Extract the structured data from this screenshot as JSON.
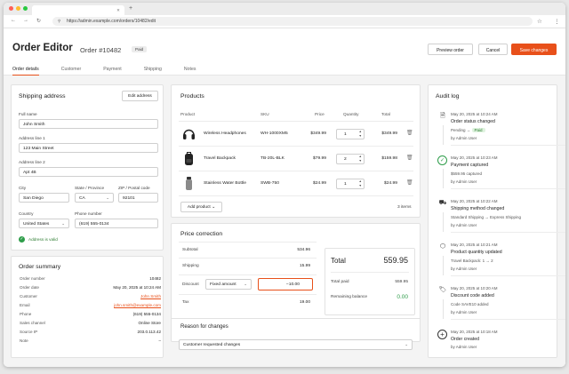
{
  "browser": {
    "tab_title": "",
    "new_tab": "+",
    "url": "https://admin.example.com/orders/10482/edit"
  },
  "header": {
    "title": "Order Editor",
    "order_number": "Order #10482",
    "status_badge": "Paid",
    "preview_label": "Preview order",
    "cancel_label": "Cancel",
    "save_label": "Save changes"
  },
  "tabs": [
    "Order details",
    "Customer",
    "Payment",
    "Shipping",
    "Notes"
  ],
  "shipping": {
    "title": "Shipping address",
    "edit_label": "Edit address",
    "full_name_label": "Full name",
    "full_name": "John Smith",
    "address1_label": "Address line 1",
    "address1": "123 Main Street",
    "address2_label": "Address line 2",
    "address2": "Apt 4B",
    "city_label": "City",
    "city": "San Diego",
    "state_label": "State / Province",
    "state": "CA",
    "zip_label": "ZIP / Postal code",
    "zip": "92101",
    "country_label": "Country",
    "country": "United States",
    "phone_label": "Phone number",
    "phone": "(619) 555-0134",
    "valid_msg": "Address is valid"
  },
  "summary": {
    "title": "Order summary",
    "rows": [
      {
        "k": "Order number",
        "v": "10482"
      },
      {
        "k": "Order date",
        "v": "May 20, 2025 at 10:24 AM"
      },
      {
        "k": "Customer",
        "v": "John Smith"
      },
      {
        "k": "Email",
        "v": "john.smith@example.com"
      },
      {
        "k": "Phone",
        "v": "(619) 555-0134"
      },
      {
        "k": "Sales channel",
        "v": "Online Store"
      },
      {
        "k": "Source IP",
        "v": "203.0.113.42"
      },
      {
        "k": "Note",
        "v": "–"
      }
    ]
  },
  "products": {
    "title": "Products",
    "headers": {
      "product": "Product",
      "sku": "SKU",
      "price": "Price",
      "quantity": "Quantity",
      "total": "Total"
    },
    "items": [
      {
        "name": "Wireless Headphones",
        "sku": "WH-1000XM5",
        "price": "$349.99",
        "qty": "1",
        "total": "$349.99"
      },
      {
        "name": "Travel Backpack",
        "sku": "TB-20L-BLK",
        "price": "$79.99",
        "qty": "2",
        "total": "$159.98"
      },
      {
        "name": "Stainless Water Bottle",
        "sku": "SWB-750",
        "price": "$24.99",
        "qty": "1",
        "total": "$24.99"
      }
    ],
    "add_label": "Add product",
    "count": "3 items"
  },
  "price": {
    "title": "Price correction",
    "subtotal_label": "Subtotal",
    "subtotal": "534.96",
    "shipping_label": "Shipping",
    "shipping": "15.99",
    "discount_label": "Discount",
    "discount_type": "Fixed amount",
    "discount_value": "−10.00",
    "tax_label": "Tax",
    "tax": "19.00",
    "total_label": "Total",
    "total": "559.95",
    "paid_label": "Total paid",
    "paid": "559.95",
    "remaining_label": "Remaining balance",
    "remaining": "0.00",
    "reason_title": "Reason for changes",
    "reason": "Customer requested changes"
  },
  "audit": {
    "title": "Audit log",
    "entries": [
      {
        "when": "May 20, 2025 at 10:24 AM",
        "what": "Order status changed",
        "det_from": "Pending",
        "det_to": "Paid",
        "by": "by Admin User"
      },
      {
        "when": "May 20, 2025 at 10:23 AM",
        "what": "Payment captured",
        "det": "$559.95 captured",
        "by": "by Admin User"
      },
      {
        "when": "May 20, 2025 at 10:22 AM",
        "what": "Shipping method changed",
        "det": "Standard Shipping → Express Shipping",
        "by": "by Admin User"
      },
      {
        "when": "May 20, 2025 at 10:21 AM",
        "what": "Product quantity updated",
        "det": "Travel Backpack: 1 → 2",
        "by": "by Admin User"
      },
      {
        "when": "May 20, 2025 at 10:20 AM",
        "what": "Discount code added",
        "det": "Code SAVE10 added",
        "by": "by Admin User"
      },
      {
        "when": "May 20, 2025 at 10:18 AM",
        "what": "Order created",
        "by": "by Admin User"
      }
    ]
  },
  "colors": {
    "accent": "#e8501a",
    "success": "#2e9d4a"
  }
}
